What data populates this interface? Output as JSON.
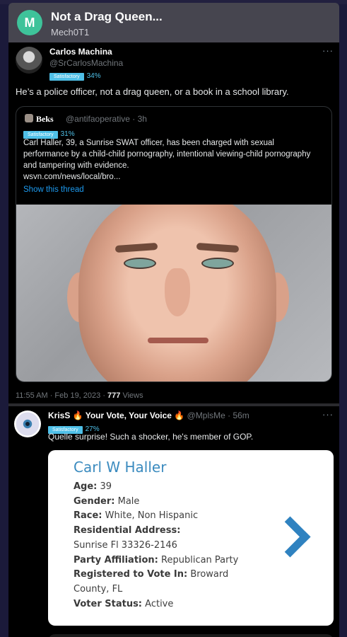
{
  "header": {
    "logo_letter": "M",
    "title": "Not a Drag Queen...",
    "subtitle": "Mech0T1"
  },
  "post1": {
    "name": "Carlos Machina",
    "handle": "@SrCarlosMachina",
    "badge": "Satisfactory",
    "percent": "34%",
    "more": "···",
    "text": "He’s a police officer, not a drag queen, or a book in a school library.",
    "quote": {
      "name": "Beks",
      "handle_time": "@antifaoperative · 3h",
      "badge": "Satisfactory",
      "percent": "31%",
      "text": "Carl Haller, 39, a Sunrise SWAT officer, has been charged with sexual performance by a child-child pornography, intentional viewing-child pornography and tampering with evidence.",
      "link_text": "wsvn.com/news/local/bro...",
      "show_thread": "Show this thread"
    },
    "timestamp": "11:55 AM · Feb 19, 2023 ·",
    "views_count": "777",
    "views_label": "Views"
  },
  "post2": {
    "name": "KrisS 🔥 Your Vote, Your Voice 🔥",
    "handle_time": "@MplsMe · 56m",
    "badge": "Satisfactory",
    "percent": "27%",
    "more": "···",
    "text": "Quelle surprise! Such a shocker, he's member of GOP.",
    "card": {
      "title": "Carl W Haller",
      "age_label": "Age:",
      "age": "39",
      "gender_label": "Gender:",
      "gender": "Male",
      "race_label": "Race:",
      "race": "White, Non Hispanic",
      "address_label": "Residential Address:",
      "address": "Sunrise Fl 33326-2146",
      "party_label": "Party Affiliation:",
      "party": "Republican Party",
      "registered_label": "Registered to Vote In:",
      "registered_1": "Broward",
      "registered_2": "County, FL",
      "status_label": "Voter Status:",
      "status": "Active"
    }
  }
}
